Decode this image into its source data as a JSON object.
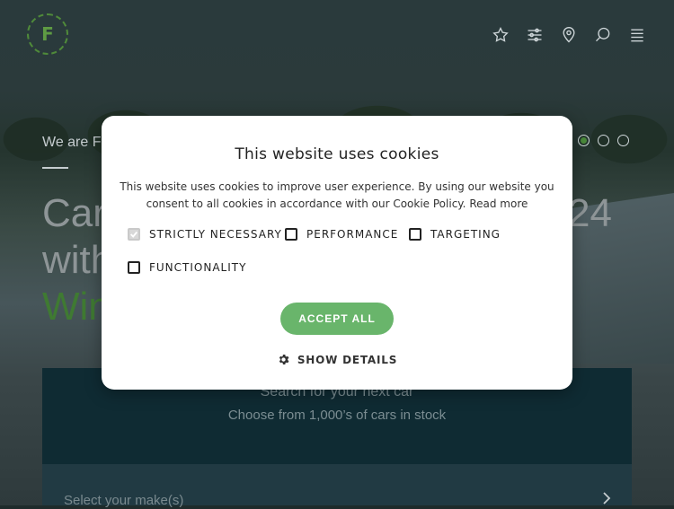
{
  "header": {
    "logo_letter": "F",
    "icons": [
      "star-icon",
      "sliders-icon",
      "location-pin-icon",
      "search-icon",
      "menu-icon"
    ]
  },
  "hero": {
    "kicker": "We are F",
    "title_line1_left": "Car",
    "title_line1_right": "24",
    "title_line2": "with",
    "title_line3": "Win",
    "accent_color": "#4a8a3b"
  },
  "carousel": {
    "dots": 3,
    "active_index": 0
  },
  "search_card": {
    "title": "Search for your next car",
    "subtitle": "Choose from 1,000’s of cars in stock",
    "make_placeholder": "Select your make(s)"
  },
  "cookie_modal": {
    "title": "This website uses cookies",
    "body": "This website uses cookies to improve user experience. By using our website you consent to all cookies in accordance with our Cookie Policy.",
    "read_more": "Read more",
    "options": [
      {
        "label": "STRICTLY NECESSARY",
        "checked": true
      },
      {
        "label": "PERFORMANCE",
        "checked": false
      },
      {
        "label": "TARGETING",
        "checked": false
      },
      {
        "label": "FUNCTIONALITY",
        "checked": false
      }
    ],
    "accept_label": "ACCEPT ALL",
    "details_label": "SHOW DETAILS",
    "accept_color": "#69b56b"
  }
}
